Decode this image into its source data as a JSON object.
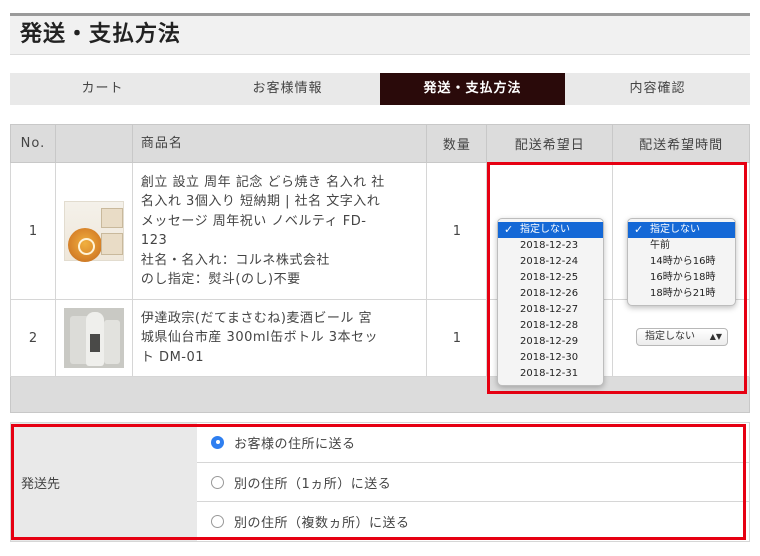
{
  "heading": {
    "title": "発送・支払方法"
  },
  "steps": [
    {
      "label": "カート",
      "active": false
    },
    {
      "label": "お客様情報",
      "active": false
    },
    {
      "label": "発送・支払方法",
      "active": true
    },
    {
      "label": "内容確認",
      "active": false
    }
  ],
  "table": {
    "headers": {
      "no": "No.",
      "name": "商品名",
      "qty": "数量",
      "date": "配送希望日",
      "time": "配送希望時間"
    },
    "rows": [
      {
        "no": "1",
        "name_lines": [
          "創立 設立 周年 記念 どら焼き 名入れ 社",
          "名入れ 3個入り 短納期 | 社名 文字入れ",
          "メッセージ 周年祝い ノベルティ FD-",
          "123",
          "社名・名入れ：コルネ株式会社",
          "のし指定：熨斗(のし)不要"
        ],
        "qty": "1",
        "image_icon": "dorayaki-product-image"
      },
      {
        "no": "2",
        "name_lines": [
          "伊達政宗(だてまさむね)麦酒ビール 宮",
          "城県仙台市産 300ml缶ボトル 3本セッ",
          "ト DM-01"
        ],
        "qty": "1",
        "image_icon": "beer-bottle-product-image"
      }
    ]
  },
  "date_dropdown": {
    "selected": "指定しない",
    "options": [
      "指定しない",
      "2018-12-23",
      "2018-12-24",
      "2018-12-25",
      "2018-12-26",
      "2018-12-27",
      "2018-12-28",
      "2018-12-29",
      "2018-12-30",
      "2018-12-31"
    ]
  },
  "time_dropdown": {
    "selected": "指定しない",
    "options": [
      "指定しない",
      "午前",
      "14時から16時",
      "16時から18時",
      "18時から21時"
    ]
  },
  "row2_time_select": {
    "value": "指定しない",
    "arrow_icon": "updown-arrows-icon"
  },
  "check_icon": "checkmark-icon",
  "shipping": {
    "label": "発送先",
    "options": [
      {
        "label": "お客様の住所に送る",
        "selected": true
      },
      {
        "label": "別の住所（1ヵ所）に送る",
        "selected": false
      },
      {
        "label": "別の住所（複数ヵ所）に送る",
        "selected": false
      }
    ]
  },
  "colors": {
    "highlight_border": "#e60012",
    "active_step": "#2a0a0a",
    "select_blue": "#1468d6",
    "radio_blue": "#2f7ff0"
  }
}
